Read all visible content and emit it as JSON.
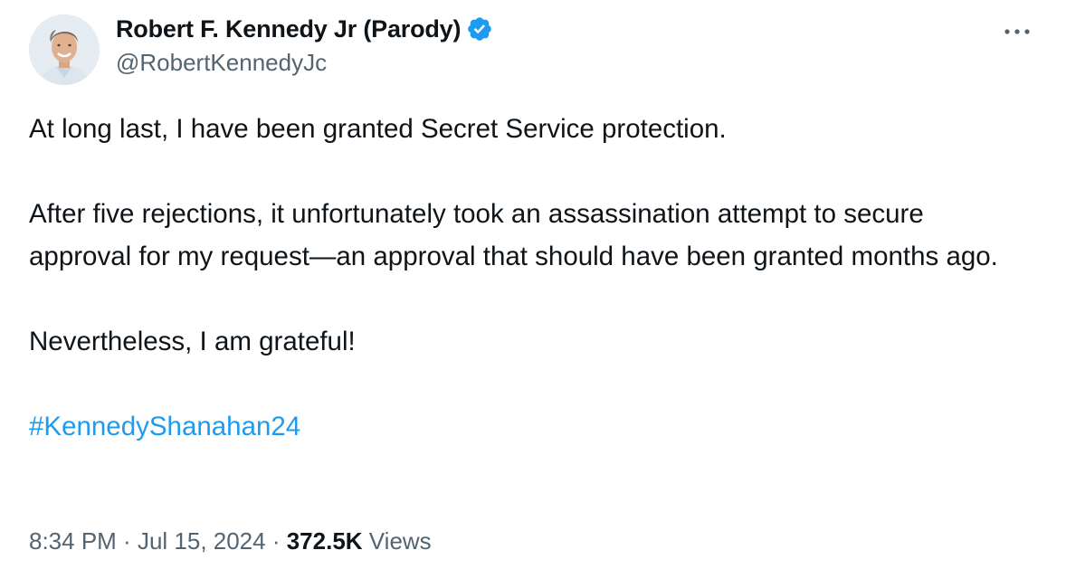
{
  "author": {
    "display_name": "Robert F. Kennedy Jr (Parody)",
    "handle": "@RobertKennedyJc",
    "verified_icon": "verified-badge-icon",
    "verified_color": "#1d9bf0",
    "avatar_alt": "profile-photo"
  },
  "menu": {
    "icon": "more-options-icon",
    "label": "···"
  },
  "tweet": {
    "paragraph_1": "At long last, I have been granted Secret Service protection.",
    "paragraph_2": "After five rejections, it unfortunately took an assassination attempt to secure approval for my request—an approval that should have been granted months ago.",
    "paragraph_3": "Nevertheless, I am grateful!",
    "hashtag": "#KennedyShanahan24"
  },
  "meta": {
    "time": "8:34 PM",
    "separator": " · ",
    "date": "Jul 15, 2024",
    "views_count": "372.5K",
    "views_label": "Views"
  },
  "colors": {
    "text_primary": "#0f1419",
    "text_secondary": "#536471",
    "link": "#1d9bf0",
    "background": "#ffffff"
  }
}
